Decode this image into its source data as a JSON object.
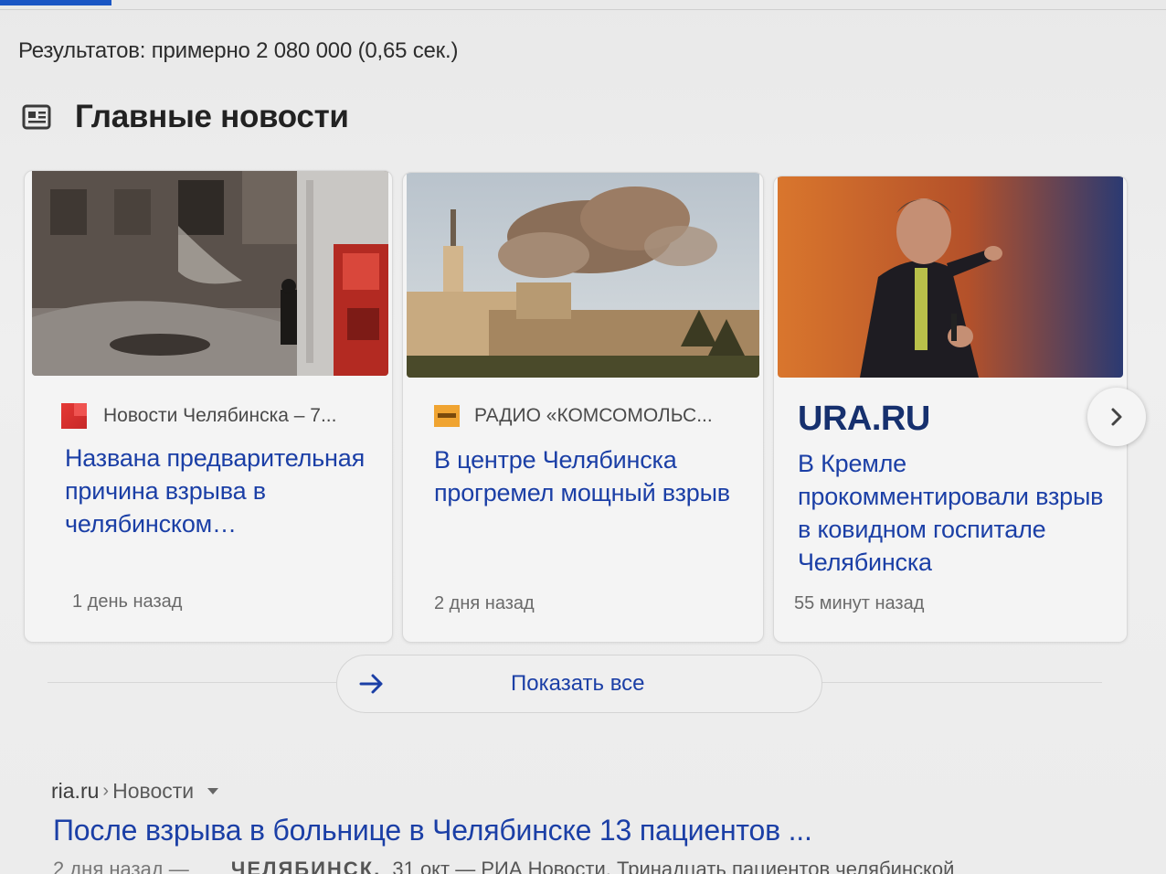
{
  "stats": "Результатов: примерно 2 080 000 (0,65 сек.)",
  "section": {
    "title": "Главные новости",
    "icon": "news-icon"
  },
  "cards": [
    {
      "source": "Новости Челябинска – 7...",
      "headline": "Названа предварительная причина взрыва в челябинском…",
      "time": "1 день назад"
    },
    {
      "source": "РАДИО «КОМСОМОЛЬС...",
      "headline": "В центре Челябинска прогремел мощный взрыв",
      "time": "2 дня назад"
    },
    {
      "source": "URA.RU",
      "headline": "В Кремле прокомментировали взрыв в ковидном госпитале Челябинска",
      "time": "55 минут назад"
    }
  ],
  "show_all": "Показать все",
  "result": {
    "domain": "ria.ru",
    "separator": "›",
    "path": "Новости",
    "title": "После взрыва в больнице в Челябинске 13 пациентов ...",
    "snippet_date": "2 дня назад —",
    "snippet_city": "ЧЕЛЯБИНСК,",
    "snippet_text": "31 окт — РИА Новости. Тринадцать пациентов челябинской"
  },
  "colors": {
    "link": "#1b3fa6",
    "accent": "#1a56c4",
    "ura_logo": "#16306e"
  }
}
